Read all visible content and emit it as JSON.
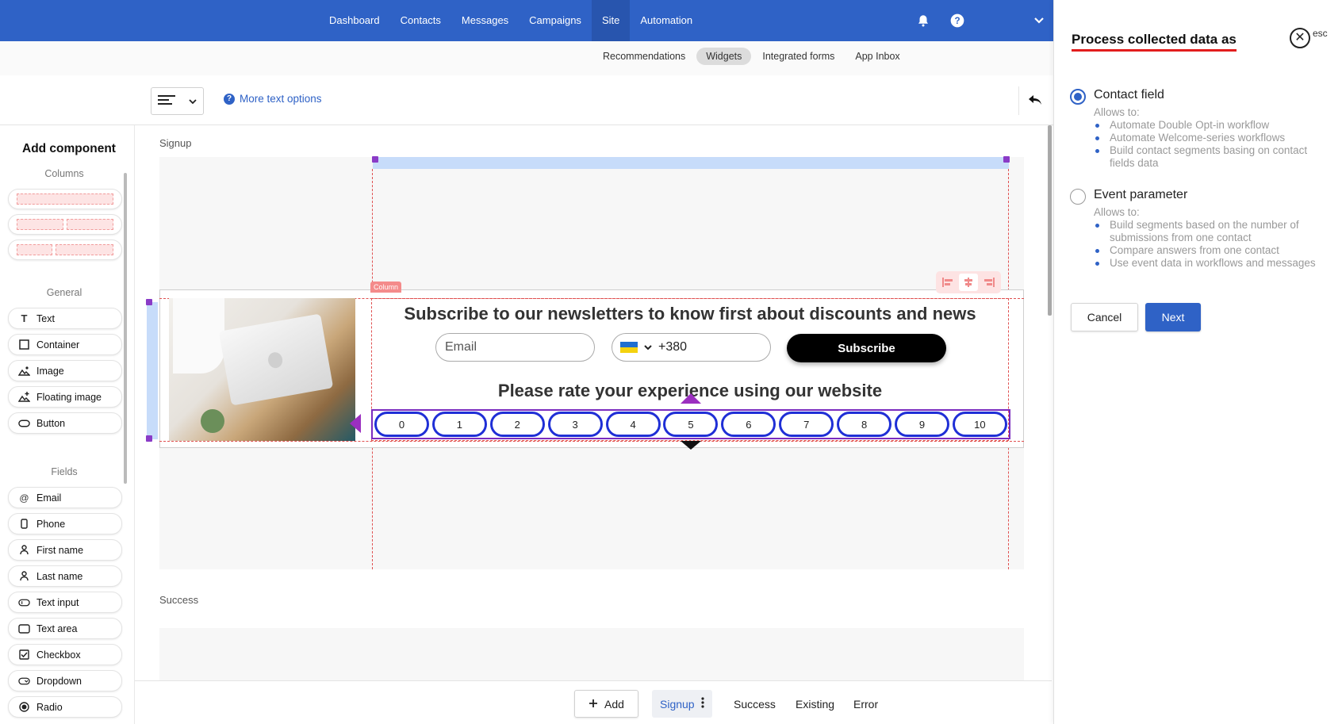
{
  "topnav": {
    "items": [
      {
        "label": "Dashboard"
      },
      {
        "label": "Contacts"
      },
      {
        "label": "Messages"
      },
      {
        "label": "Campaigns"
      },
      {
        "label": "Site",
        "active": true
      },
      {
        "label": "Automation"
      }
    ],
    "icons": [
      "bell-icon",
      "help-icon",
      "chevron-down-icon"
    ]
  },
  "subnav": {
    "items": [
      {
        "label": "Recommendations"
      },
      {
        "label": "Widgets",
        "active": true
      },
      {
        "label": "Integrated forms"
      },
      {
        "label": "App Inbox"
      }
    ]
  },
  "toolbar": {
    "more_text_options": "More text options"
  },
  "sidebar": {
    "title": "Add component",
    "columns_label": "Columns",
    "general_label": "General",
    "general_items": [
      {
        "label": "Text",
        "icon": "text-icon"
      },
      {
        "label": "Container",
        "icon": "container-icon"
      },
      {
        "label": "Image",
        "icon": "image-icon"
      },
      {
        "label": "Floating image",
        "icon": "floating-image-icon"
      },
      {
        "label": "Button",
        "icon": "button-icon"
      }
    ],
    "fields_label": "Fields",
    "field_items": [
      {
        "label": "Email",
        "icon": "at-icon"
      },
      {
        "label": "Phone",
        "icon": "phone-icon"
      },
      {
        "label": "First name",
        "icon": "person-icon"
      },
      {
        "label": "Last name",
        "icon": "person-icon"
      },
      {
        "label": "Text input",
        "icon": "text-input-icon"
      },
      {
        "label": "Text area",
        "icon": "text-area-icon"
      },
      {
        "label": "Checkbox",
        "icon": "checkbox-icon"
      },
      {
        "label": "Dropdown",
        "icon": "dropdown-icon"
      },
      {
        "label": "Radio",
        "icon": "radio-icon"
      }
    ]
  },
  "canvas": {
    "signup_label": "Signup",
    "success_label": "Success",
    "column_tag": "Column",
    "headline": "Subscribe to our newsletters to know first about discounts and news",
    "email_placeholder": "Email",
    "phone_code": "+380",
    "subscribe_label": "Subscribe",
    "rating_title": "Please rate your experience using our website",
    "rating_values": [
      "0",
      "1",
      "2",
      "3",
      "4",
      "5",
      "6",
      "7",
      "8",
      "9",
      "10"
    ],
    "colors": {
      "rating_border": "#1f2fd6",
      "selection": "#7b2cbf",
      "guide": "#e05050"
    }
  },
  "bottom": {
    "add_label": "Add",
    "tabs": [
      {
        "label": "Signup",
        "active": true
      },
      {
        "label": "Success"
      },
      {
        "label": "Existing"
      },
      {
        "label": "Error"
      }
    ]
  },
  "panel": {
    "title": "Process collected data as",
    "esc_label": "esc",
    "options": [
      {
        "label": "Contact field",
        "checked": true,
        "allows": "Allows to:",
        "bullets": [
          "Automate Double Opt-in workflow",
          "Automate Welcome-series workflows",
          "Build contact segments basing on contact fields data"
        ]
      },
      {
        "label": "Event parameter",
        "checked": false,
        "allows": "Allows to:",
        "bullets": [
          "Build segments based on the number of submissions from one contact",
          "Compare answers from one contact",
          "Use event data in workflows and messages"
        ]
      }
    ],
    "cancel_label": "Cancel",
    "next_label": "Next",
    "accent": "#2f62c6"
  }
}
